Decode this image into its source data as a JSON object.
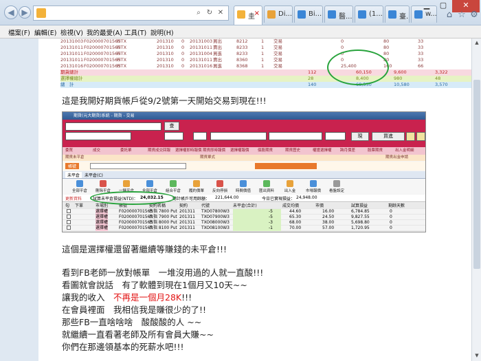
{
  "browser": {
    "address_url": "",
    "tabs": [
      {
        "label": "圭",
        "active": true,
        "color": "#f3b23a"
      },
      {
        "label": "Di...",
        "active": false,
        "color": "#e8a23a"
      },
      {
        "label": "Bi...",
        "active": false,
        "color": "#3b86d6"
      },
      {
        "label": "醫...",
        "active": false,
        "color": "#3b86d6"
      },
      {
        "label": "(1...",
        "active": false,
        "color": "#3b86d6"
      },
      {
        "label": "臺...",
        "active": false,
        "color": "#3b86d6"
      },
      {
        "label": "w...",
        "active": false,
        "color": "#3b86d6"
      }
    ],
    "menu": [
      "檔案(F)",
      "編輯(E)",
      "檢視(V)",
      "我的最愛(A)",
      "工具(T)",
      "說明(H)"
    ]
  },
  "statement": {
    "rows": [
      [
        "20131003",
        "F020000701565",
        "FITX",
        "201310",
        "0",
        "20131003",
        "買出",
        "8212",
        "1",
        "交易",
        "0",
        "80",
        "33"
      ],
      [
        "20131011",
        "F020000701565",
        "FITX",
        "201310",
        "0",
        "20131011",
        "賣出",
        "8233",
        "1",
        "交易",
        "0",
        "80",
        "33"
      ],
      [
        "20131011",
        "F020000701565",
        "FITX",
        "201310",
        "0",
        "20131004",
        "買進",
        "8233",
        "1",
        "交易",
        "0",
        "80",
        "33"
      ],
      [
        "20131011",
        "F020000701565",
        "FITX",
        "201310",
        "0",
        "20131011",
        "賣出",
        "8360",
        "1",
        "交易",
        "0",
        "80",
        "33"
      ],
      [
        "20131016",
        "F020000701565",
        "FITX",
        "201310",
        "0",
        "20131016",
        "買進",
        "8368",
        "1",
        "交易",
        "25,400",
        "160",
        "66"
      ]
    ],
    "sum_rows": [
      {
        "label": "期貨總計",
        "qty": "112",
        "amount": "60,150",
        "fee": "9,600",
        "tax": "3,322"
      },
      {
        "label": "選擇權總計",
        "qty": "28",
        "amount": "8,400",
        "fee": "980",
        "tax": "48"
      },
      {
        "label": "總　計",
        "qty": "140",
        "amount": "68,550",
        "fee": "10,580",
        "tax": "3,570"
      }
    ]
  },
  "text": {
    "line1": "這是我開好期貨帳戶從9/2號第一天開始交易到現在!!!",
    "line2": "這個是選擇權還留著繼續等賺錢的未平倉!!!",
    "line3": "看到FB老師一放對帳單　一堆沒用過的人就一直酸!!!",
    "line4": "看圖就會說話　有了軟體到現在1個月又10天~~",
    "line5a": "讓我的收入　",
    "line5b": "不再是一個月28K",
    "line5c": "!!!",
    "line6": "在會員裡面　我相信我是賺很少的了!!",
    "line7": "那些FB一直啥啥啥　酸酸酸的人 ~~",
    "line8": "就繼續一直看著老師及所有會員大賺~~",
    "line9": "你們在那邊領基本的死薪水吧!!!"
  },
  "app": {
    "title": "期貨(元大期貨)系統 - 期貨 - 交易",
    "buy_sell": "買進",
    "price_type": "現",
    "tabs": [
      "委買",
      "成交",
      "委託單",
      "期貨成交回報",
      "選擇權即時報價",
      "期貨即時報價",
      "選擇權報價",
      "個股期貨",
      "期貨歷史",
      "權證選擇權",
      "跨月價差",
      "股票期貨",
      "出入金明細"
    ],
    "account_label": "帳號",
    "position_tabs": [
      "未平倉",
      "未平倉(C)"
    ],
    "icons": [
      "全部平倉",
      "刪除平倉",
      "一鍵平倉",
      "全部平倉",
      "組合平倉",
      "履約價單",
      "反向停損",
      "時間價值",
      "匯出資料",
      "出入金",
      "市場報價",
      "看盤設定"
    ],
    "status": {
      "unrealized_label": "試算未平倉損益(NTD)：",
      "unrealized_value": "24,032.15",
      "available_label": "總計帳戶可用餘額：",
      "available_value": "221,644.00",
      "today_label": "今日已實現損益：",
      "today_value": "24,948.00",
      "refresh": "更新資料"
    },
    "columns": [
      "勾",
      "下單",
      "市場別",
      "帳號",
      "契約名稱",
      "契約",
      "代號",
      "未平倉(合計)",
      "成交均價",
      "市價",
      "試算損益",
      "剩餘天數"
    ],
    "positions": [
      {
        "side": "選擇權",
        "account": "F020000701565",
        "name": "台指 7800 Put",
        "month": "201311",
        "code": "TXO07800W3",
        "qty": "-5",
        "avg": "44.60",
        "price": "16.00",
        "pnl": "6,784.85",
        "days": "0"
      },
      {
        "side": "選擇權",
        "account": "F020000701565",
        "name": "台指 7900 Put",
        "month": "201311",
        "code": "TXO07900W3",
        "qty": "-5",
        "avg": "65.30",
        "price": "24.50",
        "pnl": "9,827.55",
        "days": "0"
      },
      {
        "side": "選擇權",
        "account": "F020000701565",
        "name": "台指 8000 Put",
        "month": "201311",
        "code": "TXO08000W3",
        "qty": "-3",
        "avg": "68.00",
        "price": "38.00",
        "pnl": "5,698.80",
        "days": "0"
      },
      {
        "side": "選擇權",
        "account": "F020000701565",
        "name": "台指 8100 Put",
        "month": "201311",
        "code": "TXO08100W3",
        "qty": "-1",
        "avg": "70.00",
        "price": "57.00",
        "pnl": "1,720.95",
        "days": "0"
      }
    ]
  }
}
